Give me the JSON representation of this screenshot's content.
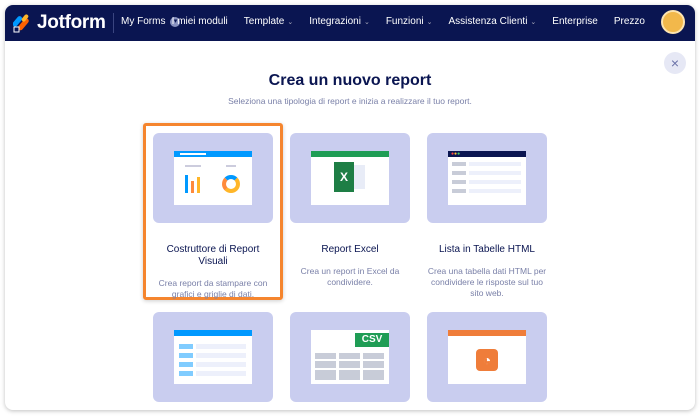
{
  "nav": {
    "brand": "Jotform",
    "my_forms": "My Forms",
    "items": [
      {
        "label": "I miei moduli",
        "caret": false
      },
      {
        "label": "Template",
        "caret": true
      },
      {
        "label": "Integrazioni",
        "caret": true
      },
      {
        "label": "Funzioni",
        "caret": true
      },
      {
        "label": "Assistenza Clienti",
        "caret": true
      },
      {
        "label": "Enterprise",
        "caret": false
      },
      {
        "label": "Prezzo",
        "caret": false
      }
    ]
  },
  "dialog": {
    "title": "Crea un nuovo report",
    "subtitle": "Seleziona una tipologia di report e inizia a realizzare il tuo report.",
    "close_icon": "×"
  },
  "cards": [
    {
      "title": "Costruttore di Report Visuali",
      "desc": "Crea report da stampare con grafici e griglie di dati.",
      "selected": true
    },
    {
      "title": "Report Excel",
      "desc": "Crea un report in Excel da condividere."
    },
    {
      "title": "Lista in Tabelle HTML",
      "desc": "Crea una tabella dati HTML per condividere le risposte sul tuo sito web."
    },
    {
      "title": "",
      "desc": ""
    },
    {
      "title": "",
      "desc": "",
      "badge": "CSV"
    },
    {
      "title": "",
      "desc": ""
    }
  ],
  "colors": {
    "navy": "#0a1551",
    "accent": "#f5852e",
    "card": "#c9cdef"
  }
}
